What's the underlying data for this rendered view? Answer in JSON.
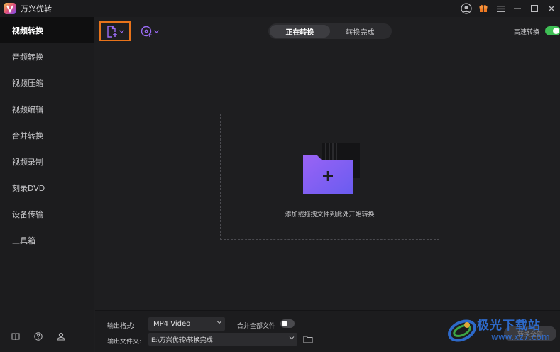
{
  "app": {
    "title": "万兴优转"
  },
  "colors": {
    "accent_orange": "#e8731a",
    "purple": "#8b5cf6",
    "toggle_green": "#3fbf55",
    "watermark_blue": "#2f6fd6"
  },
  "titlebar": {
    "icons": [
      "avatar-icon",
      "gift-icon",
      "menu-icon",
      "minimize-icon",
      "maximize-icon",
      "close-icon"
    ]
  },
  "sidebar": {
    "items": [
      {
        "label": "视频转换",
        "active": true
      },
      {
        "label": "音频转换"
      },
      {
        "label": "视频压缩"
      },
      {
        "label": "视频编辑"
      },
      {
        "label": "合并转换"
      },
      {
        "label": "视频录制"
      },
      {
        "label": "刻录DVD"
      },
      {
        "label": "设备传输"
      },
      {
        "label": "工具箱"
      }
    ],
    "bottom_icons": [
      "book-icon",
      "help-icon",
      "account-icon"
    ]
  },
  "toolbar": {
    "tabs": [
      {
        "label": "正在转换",
        "active": true
      },
      {
        "label": "转换完成"
      }
    ],
    "high_speed": {
      "label": "高速转换",
      "enabled": true
    }
  },
  "dropzone": {
    "text": "添加或拖拽文件到此处开始转换"
  },
  "bottom": {
    "format_label": "输出格式:",
    "format_value": "MP4 Video",
    "merge_label": "合并全部文件",
    "merge_enabled": false,
    "dir_label": "输出文件夹:",
    "dir_value": "E:\\万兴优转\\转换完成",
    "convert_all_label": "转换全部"
  },
  "watermark": {
    "text": "极光下载站",
    "url": "www.xz7.com"
  }
}
